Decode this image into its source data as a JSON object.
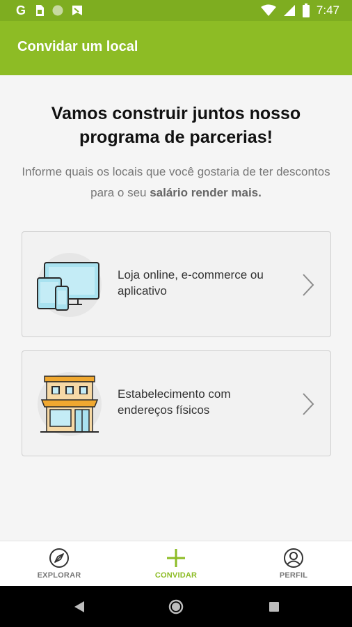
{
  "status_bar": {
    "time": "7:47",
    "icons": [
      "google-icon",
      "sim-card-icon",
      "circle-icon",
      "flag-icon",
      "wifi-icon",
      "signal-icon",
      "battery-icon"
    ]
  },
  "app_bar": {
    "title": "Convidar um local"
  },
  "main": {
    "headline": "Vamos construir juntos nosso programa de parcerias!",
    "subtitle_text": "Informe quais os locais que você gostaria de ter descontos para o seu ",
    "subtitle_bold": "salário render mais.",
    "options": [
      {
        "label": "Loja online, e-commerce ou aplicativo",
        "icon": "devices-icon"
      },
      {
        "label": "Estabelecimento com endereços físicos",
        "icon": "storefront-icon"
      }
    ]
  },
  "bottom_nav": {
    "items": [
      {
        "label": "EXPLORAR",
        "icon": "compass-icon"
      },
      {
        "label": "CONVIDAR",
        "icon": "plus-icon",
        "active": true
      },
      {
        "label": "PERFIL",
        "icon": "profile-icon"
      }
    ]
  },
  "colors": {
    "accent": "#8dbc25",
    "status_bar": "#7ead20",
    "inactive": "#777777"
  }
}
